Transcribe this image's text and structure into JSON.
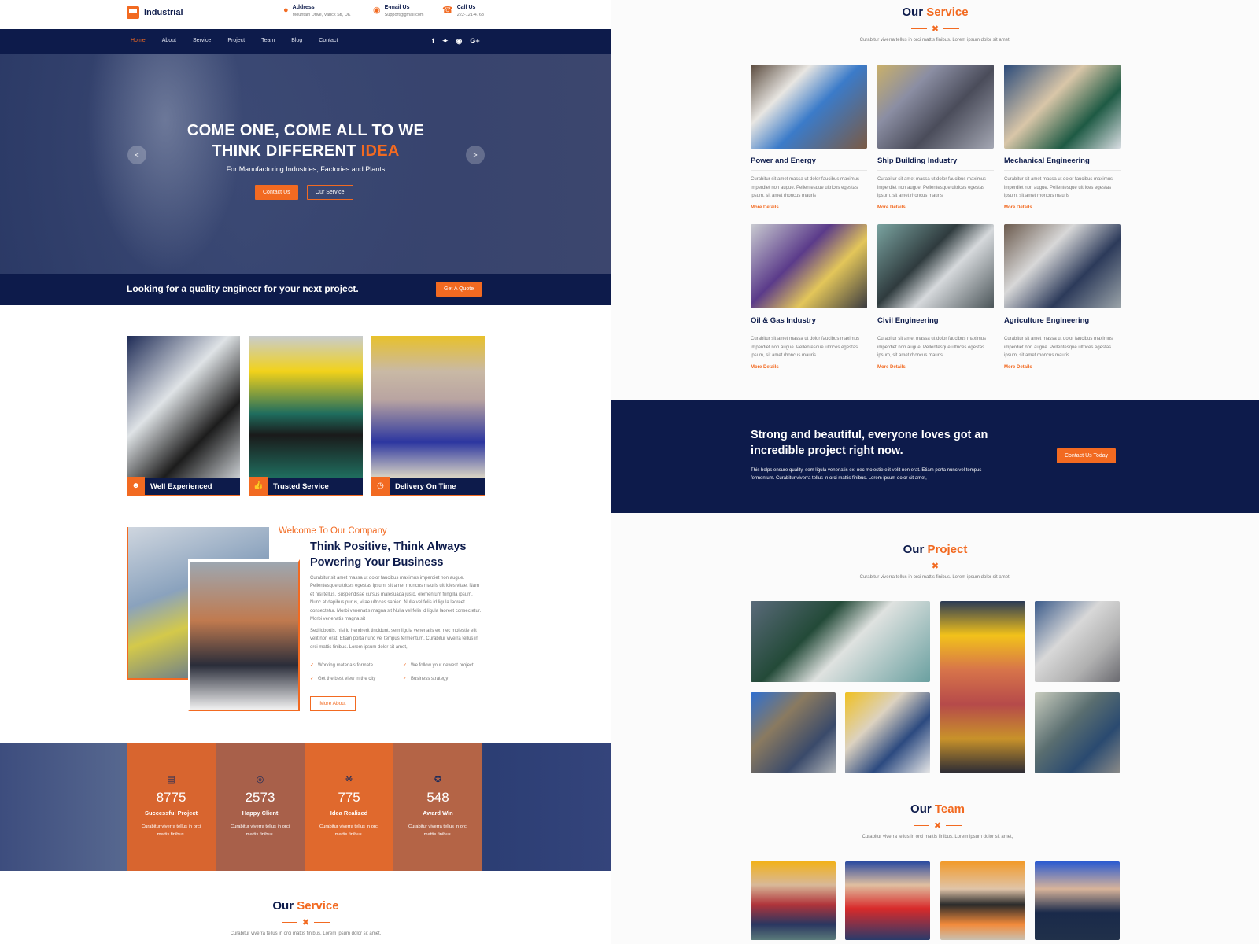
{
  "header": {
    "brand": "Industrial",
    "contacts": [
      {
        "icon": "map-pin-icon",
        "title": "Address",
        "value": "Mountain Drive, Varick Str, UK"
      },
      {
        "icon": "email-icon",
        "title": "E-mail Us",
        "value": "Support@gmail.com"
      },
      {
        "icon": "phone-icon",
        "title": "Call Us",
        "value": "222-121-4763"
      }
    ]
  },
  "nav": {
    "items": [
      "Home",
      "About",
      "Service",
      "Project",
      "Team",
      "Blog",
      "Contact"
    ],
    "active": "Home",
    "social": [
      "f",
      "t",
      "r",
      "G+"
    ]
  },
  "hero": {
    "title_line1": "COME ONE, COME ALL TO WE",
    "title_line2_pre": "THINK DIFFERENT ",
    "title_line2_accent": "IDEA",
    "subtitle": "For Manufacturing Industries, Factories and Plants",
    "btn_primary": "Contact Us",
    "btn_secondary": "Our Service",
    "prev": "<",
    "next": ">"
  },
  "quote_bar": {
    "text": "Looking for a quality engineer for your next project.",
    "button": "Get A Quote"
  },
  "features": [
    {
      "icon": "engineer-icon",
      "label": "Well Experienced"
    },
    {
      "icon": "thumbs-up-icon",
      "label": "Trusted Service"
    },
    {
      "icon": "clock-icon",
      "label": "Delivery On Time"
    }
  ],
  "about": {
    "welcome": "Welcome To Our Company",
    "title": "Think Positive, Think Always Powering Your Business",
    "para1": "Curabitur sit amet massa ut dolor faucibus maximus imperdiet non augue. Pellentesque ultrices egestas ipsum, sit amet rhoncus mauris ultricies vitae. Nam et nisi tellus. Suspendisse cursus malesuada justo, elementum fringilla ipsum. Nunc at dapibus purus, vitae ultrices sapien. Nulla vel felis id ligula laoreet consectetur. Morbi venenatis magna sit Nulla vel felis id ligula laoreet consectetur. Morbi venenatis magna sit",
    "para2": "Sed lobortis, nisl id hendrerit tincidunt, sem ligula venenatis ex, nec molestie elit velit non erat. Etiam porta nunc vel tempus fermentum. Curabitur viverra tellus in orci mattis finibus. Lorem ipsum dolor sit amet,",
    "checks": [
      "Working materials formate",
      "We follow your newest project",
      "Get the best view in the city",
      "Business strategy"
    ],
    "button": "More About"
  },
  "stats": [
    {
      "icon": "clipboard-icon",
      "value": "8775",
      "label": "Successful Project",
      "desc": "Curabitur viverra tellus in orci mattis finibus."
    },
    {
      "icon": "target-icon",
      "value": "2573",
      "label": "Happy Client",
      "desc": "Curabitur viverra tellus in orci mattis finibus."
    },
    {
      "icon": "lightbulb-icon",
      "value": "775",
      "label": "Idea Realized",
      "desc": "Curabitur viverra tellus in orci mattis finibus."
    },
    {
      "icon": "award-icon",
      "value": "548",
      "label": "Award Win",
      "desc": "Curabitur viverra tellus in orci mattis finibus."
    }
  ],
  "service_section": {
    "title_pre": "Our ",
    "title_accent": "Service",
    "subtitle": "Curabitur viverra tellus in orci mattis finibus. Lorem ipsum dolor sit amet,",
    "cards": [
      {
        "title": "Power and Energy",
        "desc": "Curabitur sit amet massa ut dolor faucibus maximus imperdiet non augue. Pellentesque ultrices egestas ipsum, sit amet rhoncus mauris",
        "more": "More Details"
      },
      {
        "title": "Ship Building Industry",
        "desc": "Curabitur sit amet massa ut dolor faucibus maximus imperdiet non augue. Pellentesque ultrices egestas ipsum, sit amet rhoncus mauris",
        "more": "More Details"
      },
      {
        "title": "Mechanical Engineering",
        "desc": "Curabitur sit amet massa ut dolor faucibus maximus imperdiet non augue. Pellentesque ultrices egestas ipsum, sit amet rhoncus mauris",
        "more": "More Details"
      },
      {
        "title": "Oil & Gas Industry",
        "desc": "Curabitur sit amet massa ut dolor faucibus maximus imperdiet non augue. Pellentesque ultrices egestas ipsum, sit amet rhoncus mauris",
        "more": "More Details"
      },
      {
        "title": "Civil Engineering",
        "desc": "Curabitur sit amet massa ut dolor faucibus maximus imperdiet non augue. Pellentesque ultrices egestas ipsum, sit amet rhoncus mauris",
        "more": "More Details"
      },
      {
        "title": "Agriculture Engineering",
        "desc": "Curabitur sit amet massa ut dolor faucibus maximus imperdiet non augue. Pellentesque ultrices egestas ipsum, sit amet rhoncus mauris",
        "more": "More Details"
      }
    ]
  },
  "cta": {
    "title": "Strong and beautiful, everyone loves got an incredible project right now.",
    "text": "This helps ensure quality, sem ligula venenatis ex, nec molestie elit velit non erat. Etiam porta nunc vel tempus fermentum. Curabitur viverra tellus in orci mattis finibus. Lorem ipsum dolor sit amet,",
    "button": "Contact Us Today"
  },
  "project_section": {
    "title_pre": "Our ",
    "title_accent": "Project",
    "subtitle": "Curabitur viverra tellus in orci mattis finibus. Lorem ipsum dolor sit amet,"
  },
  "team_section": {
    "title_pre": "Our ",
    "title_accent": "Team",
    "subtitle": "Curabitur viverra tellus in orci mattis finibus. Lorem ipsum dolor sit amet,"
  },
  "colors": {
    "primary": "#0d1b4b",
    "accent": "#f26a21"
  }
}
